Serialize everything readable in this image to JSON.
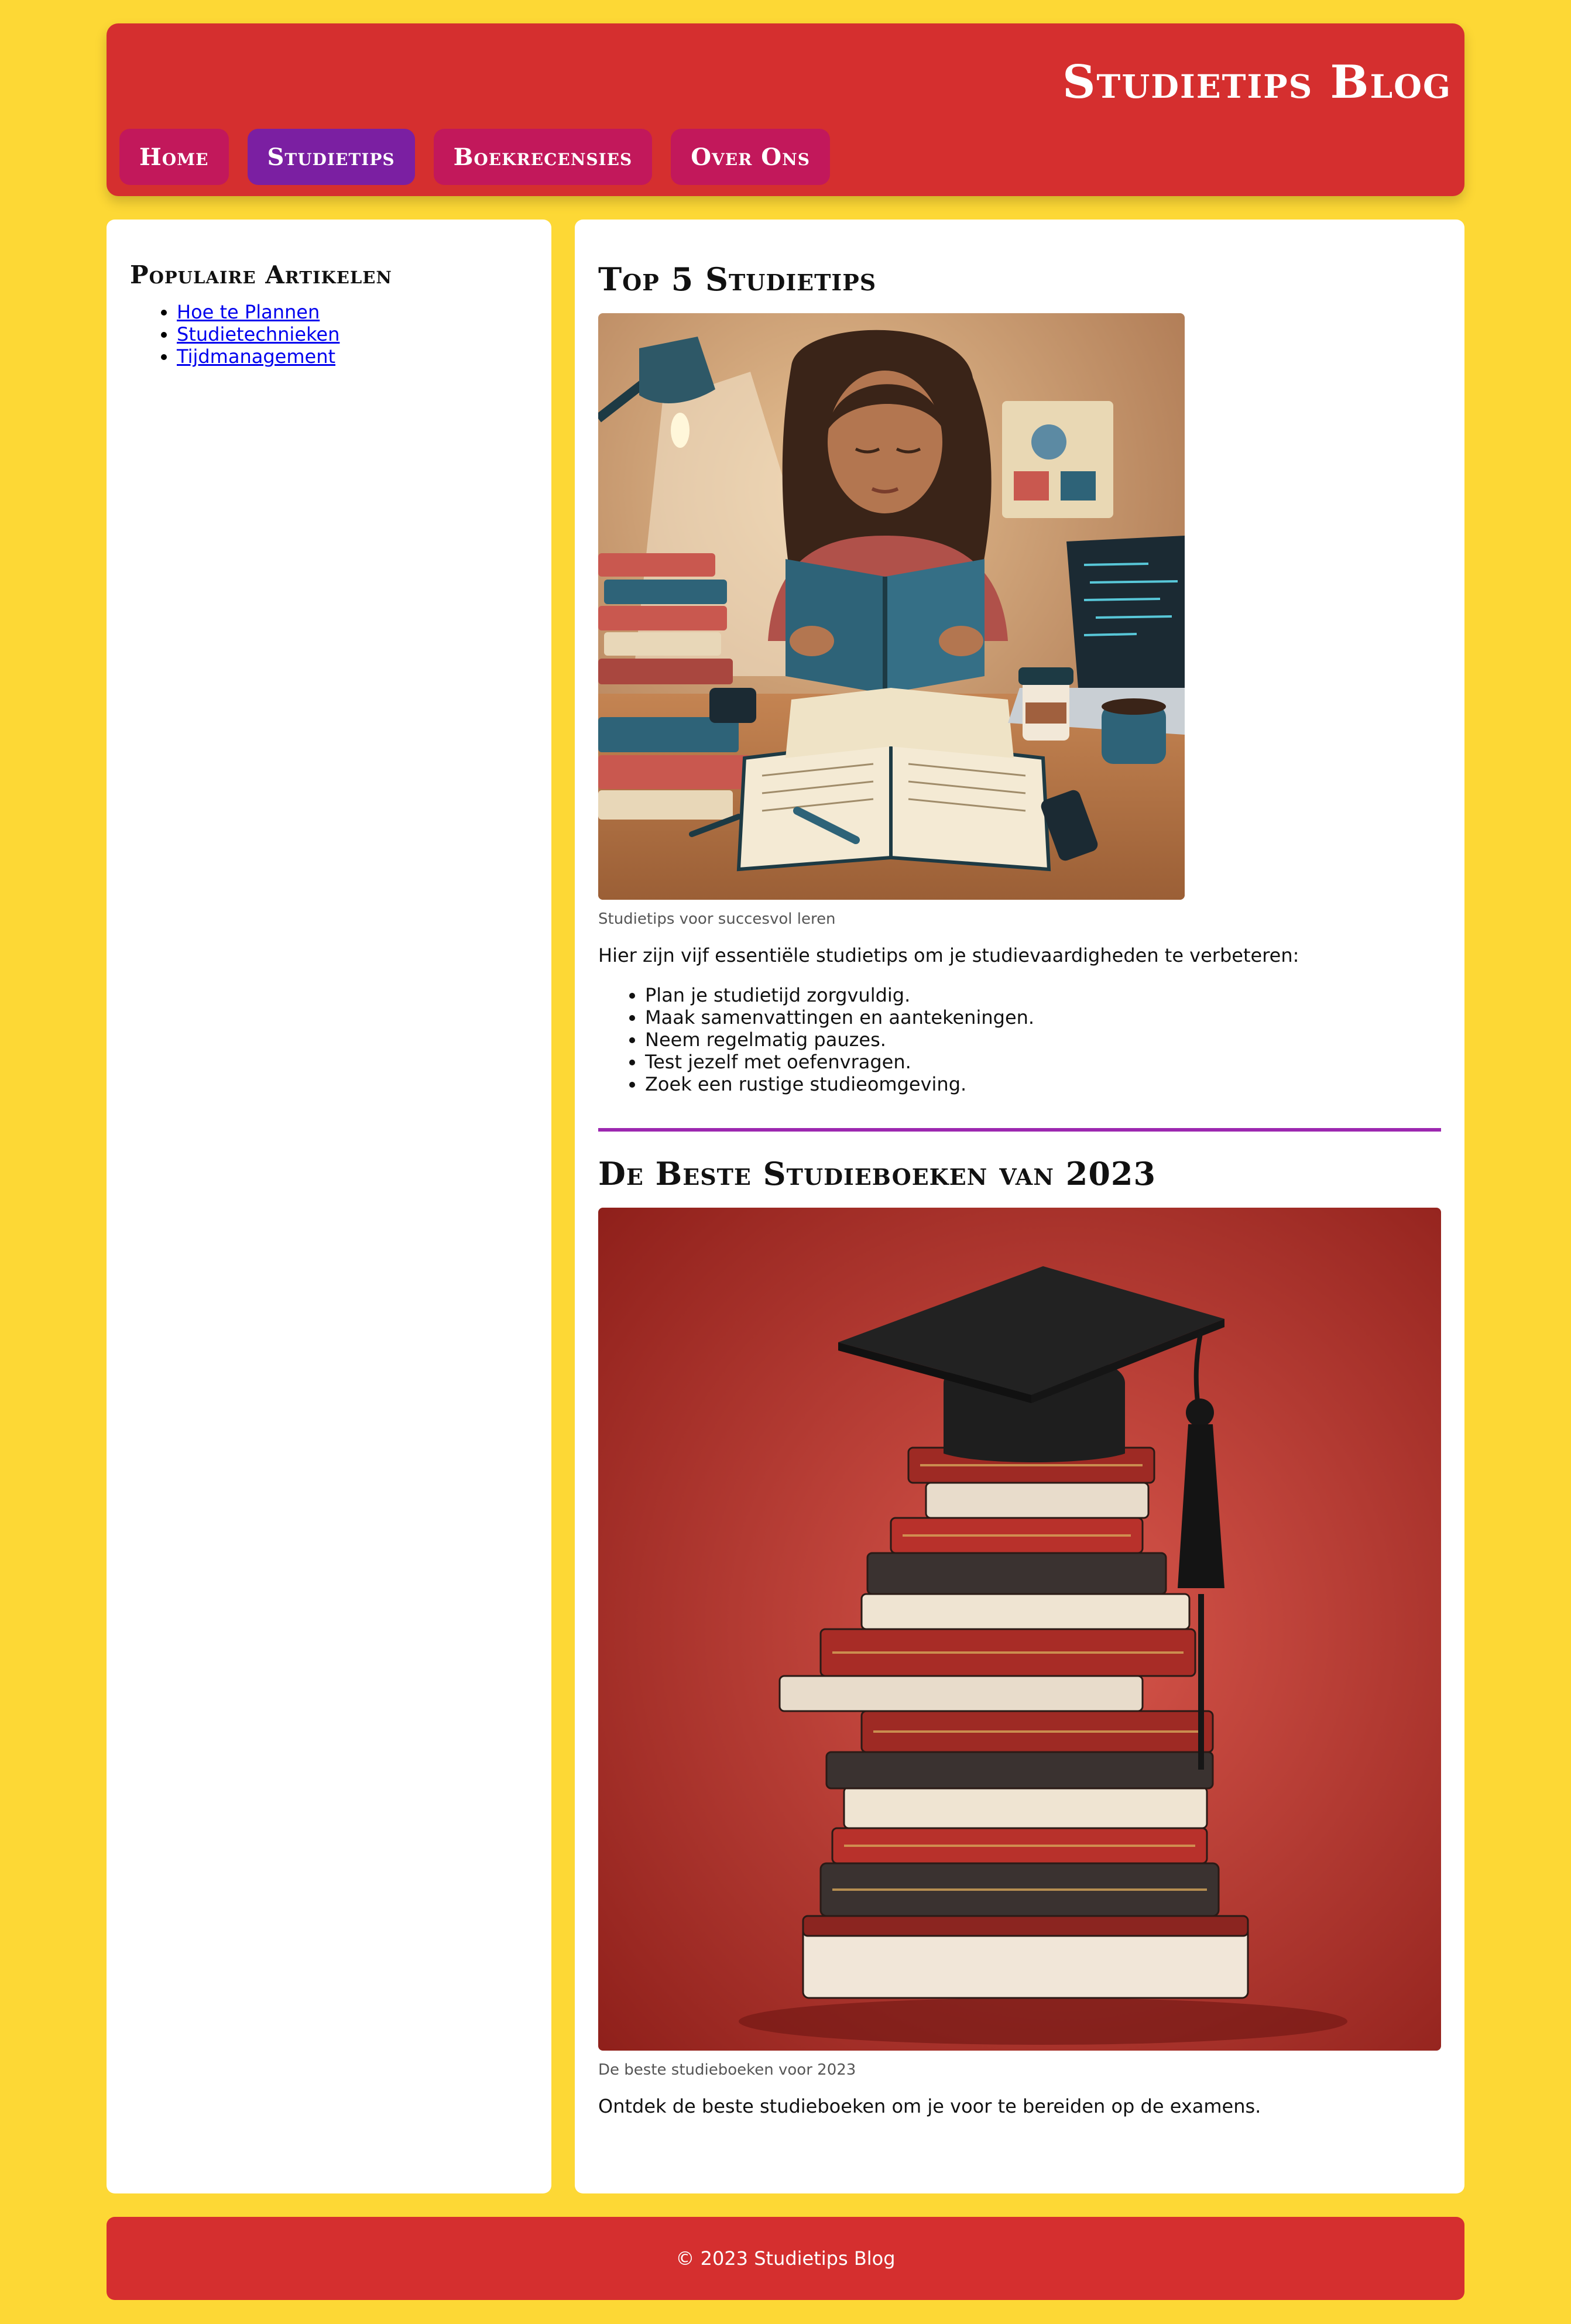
{
  "header": {
    "title": "Studietips Blog",
    "nav": [
      {
        "label": "Home",
        "active": false
      },
      {
        "label": "Studietips",
        "active": true
      },
      {
        "label": "Boekrecensies",
        "active": false
      },
      {
        "label": "Over Ons",
        "active": false
      }
    ]
  },
  "sidebar": {
    "heading": "Populaire Artikelen",
    "links": [
      "Hoe te Plannen",
      "Studietechnieken",
      "Tijdmanagement"
    ]
  },
  "main": {
    "article1": {
      "title": "Top 5 Studietips",
      "image_caption": "Studietips voor succesvol leren",
      "intro": "Hier zijn vijf essentiële studietips om je studievaardigheden te verbeteren:",
      "tips": [
        "Plan je studietijd zorgvuldig.",
        "Maak samenvattingen en aantekeningen.",
        "Neem regelmatig pauzes.",
        "Test jezelf met oefenvragen.",
        "Zoek een rustige studieomgeving."
      ]
    },
    "article2": {
      "title": "De Beste Studieboeken van 2023",
      "image_caption": "De beste studieboeken voor 2023",
      "text": "Ontdek de beste studieboeken om je voor te bereiden op de examens."
    }
  },
  "footer": {
    "text": "© 2023 Studietips Blog"
  },
  "colors": {
    "page_bg": "#fdd835",
    "header_bg": "#d52f2f",
    "nav_button": "#c2185b",
    "nav_active": "#7b1fa2",
    "divider": "#9c27b0"
  }
}
